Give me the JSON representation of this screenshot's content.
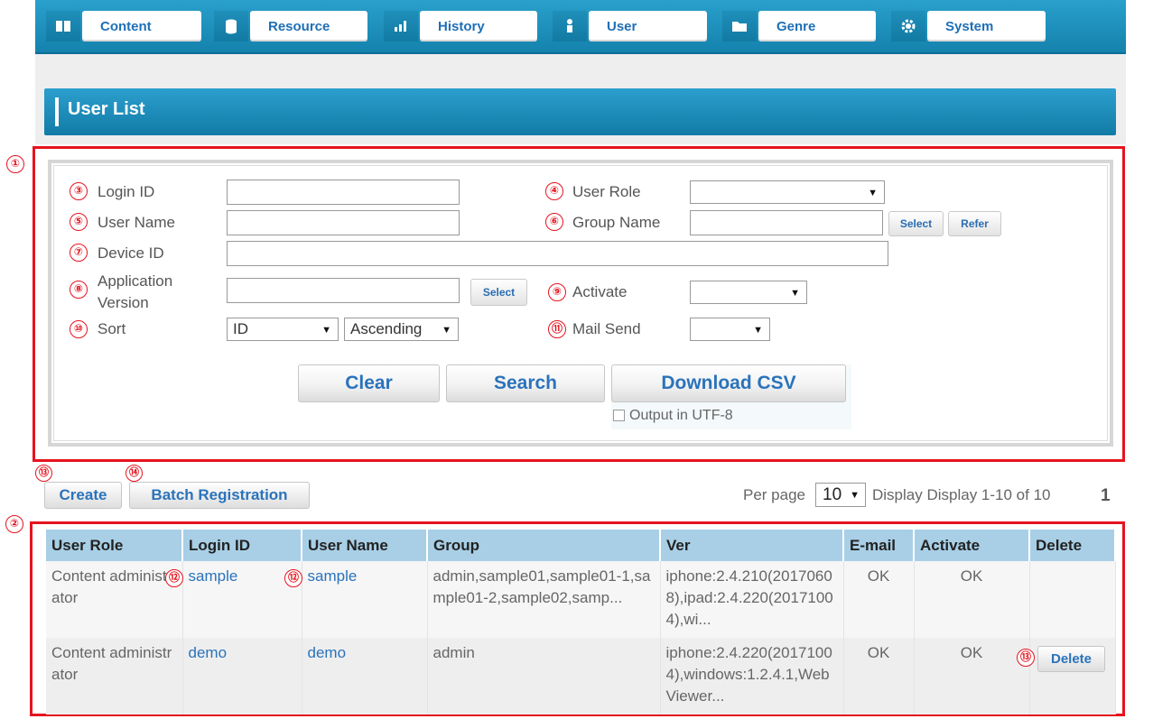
{
  "nav": {
    "items": [
      {
        "label": "Content",
        "icon": "book-icon"
      },
      {
        "label": "Resource",
        "icon": "database-icon"
      },
      {
        "label": "History",
        "icon": "bar-chart-icon"
      },
      {
        "label": "User",
        "icon": "user-icon"
      },
      {
        "label": "Genre",
        "icon": "folder-icon"
      },
      {
        "label": "System",
        "icon": "gear-icon"
      }
    ]
  },
  "page": {
    "title": "User List"
  },
  "annotations": [
    "①",
    "②",
    "③",
    "④",
    "⑤",
    "⑥",
    "⑦",
    "⑧",
    "⑨",
    "⑩",
    "⑪",
    "⑫",
    "⑬",
    "⑭"
  ],
  "search": {
    "login_id_label": "Login ID",
    "user_role_label": "User Role",
    "user_role_value": "",
    "user_name_label": "User Name",
    "group_name_label": "Group Name",
    "select_label": "Select",
    "refer_label": "Refer",
    "device_id_label": "Device ID",
    "app_version_label_1": "Application",
    "app_version_label_2": "Version",
    "activate_label": "Activate",
    "activate_value": "",
    "sort_label": "Sort",
    "sort_field": "ID",
    "sort_order": "Ascending",
    "mail_send_label": "Mail Send",
    "mail_send_value": "",
    "clear_label": "Clear",
    "search_label": "Search",
    "download_csv_label": "Download CSV",
    "utf8_label": "Output in UTF-8"
  },
  "actions": {
    "create_label": "Create",
    "batch_label": "Batch Registration",
    "per_page_label": "Per page",
    "per_page_value": "10",
    "display_text": "Display Display 1-10 of 10",
    "page_number": "1"
  },
  "table": {
    "headers": [
      "User Role",
      "Login ID",
      "User Name",
      "Group",
      "Ver",
      "E-mail",
      "Activate",
      "Delete"
    ],
    "rows": [
      {
        "role": "Content administrator",
        "login_id": "sample",
        "user_name": "sample",
        "group": "admin,sample01,sample01-1,sample01-2,sample02,samp...",
        "ver": "iphone:2.4.210(20170608),ipad:2.4.220(20171004),wi...",
        "email": "OK",
        "activate": "OK",
        "delete": ""
      },
      {
        "role": "Content administrator",
        "login_id": "demo",
        "user_name": "demo",
        "group": "admin",
        "ver": "iphone:2.4.220(20171004),windows:1.2.4.1,WebViewer...",
        "email": "OK",
        "activate": "OK",
        "delete": "Delete"
      }
    ]
  }
}
